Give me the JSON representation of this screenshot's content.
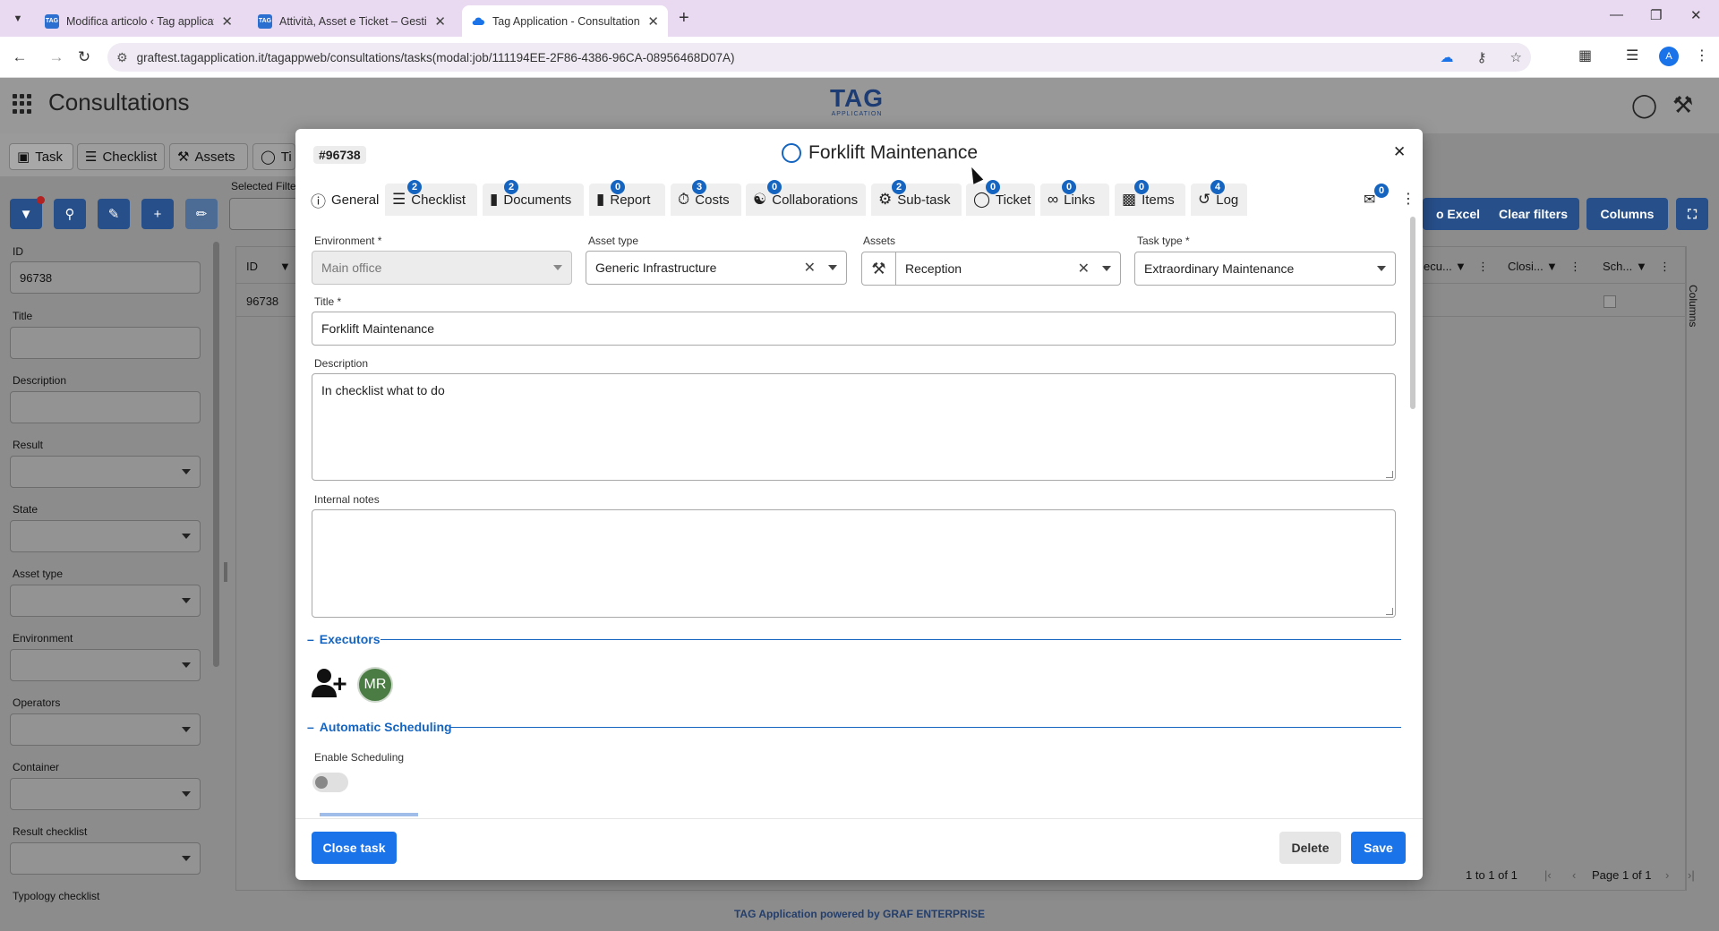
{
  "browser": {
    "tabs": [
      {
        "title": "Modifica articolo ‹ Tag applicat",
        "fav": "TAG"
      },
      {
        "title": "Attività, Asset e Ticket – Gestio",
        "fav": "TAG"
      },
      {
        "title": "Tag Application - Consultations",
        "fav": ""
      }
    ],
    "url": "graftest.tagapplication.it/tagappweb/consultations/tasks(modal:job/111194EE-2F86-4386-96CA-08956468D07A)",
    "profile_initial": "A"
  },
  "app": {
    "title": "Consultations",
    "logo_main": "TAG",
    "logo_sub": "APPLICATION",
    "tabs": [
      {
        "label": "Task"
      },
      {
        "label": "Checklist"
      },
      {
        "label": "Assets"
      },
      {
        "label": "Ti"
      }
    ],
    "selected_filter_label": "Selected Filte",
    "filters": [
      {
        "label": "ID",
        "value": "96738"
      },
      {
        "label": "Title",
        "value": ""
      },
      {
        "label": "Description",
        "value": ""
      },
      {
        "label": "Result",
        "value": ""
      },
      {
        "label": "State",
        "value": ""
      },
      {
        "label": "Asset type",
        "value": ""
      },
      {
        "label": "Environment",
        "value": ""
      },
      {
        "label": "Operators",
        "value": ""
      },
      {
        "label": "Container",
        "value": ""
      },
      {
        "label": "Result checklist",
        "value": ""
      },
      {
        "label": "Typology checklist",
        "value": ""
      }
    ],
    "grid": {
      "col_id": "ID",
      "col_exec": "ecu...",
      "col_closing": "Closi...",
      "col_sch": "Sch...",
      "row_id": "96738",
      "columns_side": "Columns"
    },
    "buttons": {
      "excel": "o Excel",
      "clear_filters": "Clear filters",
      "columns": "Columns"
    },
    "pager": {
      "range": "1 to 1 of 1",
      "page": "Page 1 of 1"
    },
    "footer": "TAG Application powered by GRAF ENTERPRISE"
  },
  "modal": {
    "job_id": "#96738",
    "title": "Forklift Maintenance",
    "tabs": [
      {
        "label": "General",
        "badge": ""
      },
      {
        "label": "Checklist",
        "badge": "2"
      },
      {
        "label": "Documents",
        "badge": "2"
      },
      {
        "label": "Report",
        "badge": "0"
      },
      {
        "label": "Costs",
        "badge": "3"
      },
      {
        "label": "Collaborations",
        "badge": "0"
      },
      {
        "label": "Sub-task",
        "badge": "2"
      },
      {
        "label": "Ticket",
        "badge": "0"
      },
      {
        "label": "Links",
        "badge": "0"
      },
      {
        "label": "Items",
        "badge": "0"
      },
      {
        "label": "Log",
        "badge": "4"
      }
    ],
    "chat_badge": "0",
    "fields": {
      "environment_label": "Environment *",
      "environment_value": "Main office",
      "asset_type_label": "Asset type",
      "asset_type_value": "Generic Infrastructure",
      "assets_label": "Assets",
      "assets_value": "Reception",
      "task_type_label": "Task type *",
      "task_type_value": "Extraordinary Maintenance",
      "title_label": "Title *",
      "title_value": "Forklift Maintenance",
      "description_label": "Description",
      "description_value": "In checklist what to do",
      "notes_label": "Internal notes",
      "notes_value": ""
    },
    "executors": {
      "section": "Executors",
      "avatar_initials": "MR"
    },
    "scheduling": {
      "section": "Automatic Scheduling",
      "enable_label": "Enable Scheduling",
      "enabled": false
    },
    "footer": {
      "close_task": "Close task",
      "delete": "Delete",
      "save": "Save"
    }
  },
  "colors": {
    "primary": "#1a73e8",
    "section_blue": "#1565c0",
    "avatar_green": "#4a7c43",
    "browser_tabstrip": "#e9d9f1"
  }
}
